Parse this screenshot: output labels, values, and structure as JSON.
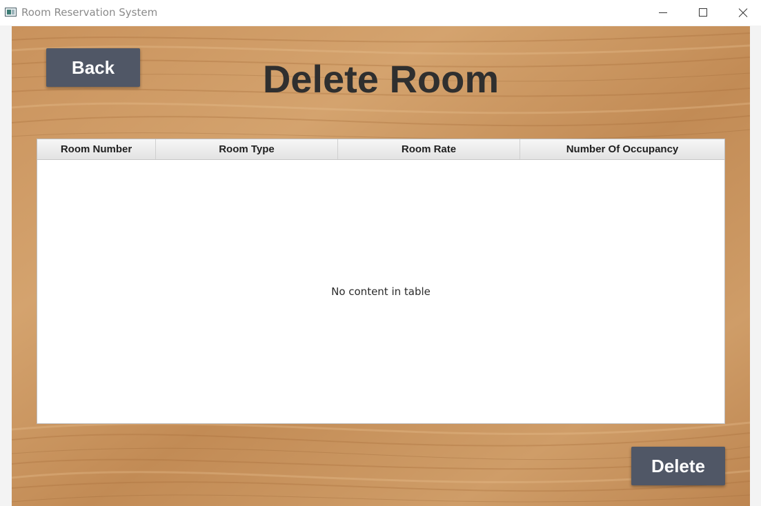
{
  "window": {
    "title": "Room Reservation System"
  },
  "page": {
    "title": "Delete Room",
    "back_label": "Back",
    "delete_label": "Delete"
  },
  "table": {
    "columns": [
      "Room Number",
      "Room Type",
      "Room Rate",
      "Number Of Occupancy"
    ],
    "rows": [],
    "empty_message": "No content in table"
  },
  "colors": {
    "button_bg": "#505766",
    "title_text": "#2f2f2f",
    "wood_base": "#c48e58"
  },
  "icons": {
    "window_minimize": "minimize-icon",
    "window_maximize": "maximize-icon",
    "window_close": "close-icon",
    "app": "app-icon"
  }
}
